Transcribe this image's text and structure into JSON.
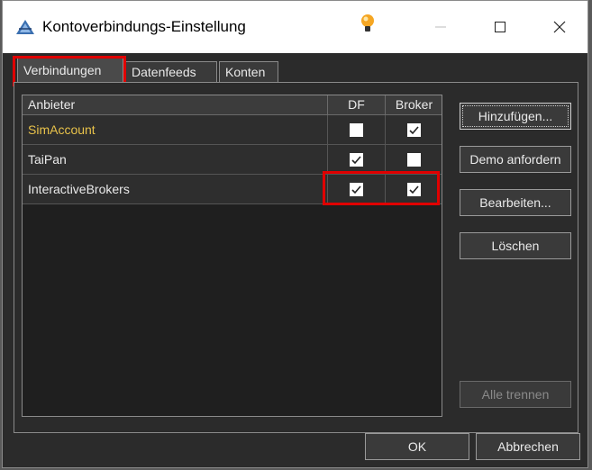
{
  "window": {
    "title": "Kontoverbindungs-Einstellung",
    "accent": "#e00000"
  },
  "tabs": [
    {
      "label": "Verbindungen",
      "active": true
    },
    {
      "label": "Datenfeeds",
      "active": false
    },
    {
      "label": "Konten",
      "active": false
    }
  ],
  "table": {
    "columns": [
      "Anbieter",
      "DF",
      "Broker"
    ],
    "rows": [
      {
        "name": "SimAccount",
        "df": false,
        "broker": true
      },
      {
        "name": "TaiPan",
        "df": true,
        "broker": false
      },
      {
        "name": "InteractiveBrokers",
        "df": true,
        "broker": true
      }
    ]
  },
  "buttons": {
    "add": "Hinzufügen...",
    "demo": "Demo anfordern",
    "edit": "Bearbeiten...",
    "delete": "Löschen",
    "disconnect_all": "Alle trennen",
    "ok": "OK",
    "cancel": "Abbrechen"
  }
}
